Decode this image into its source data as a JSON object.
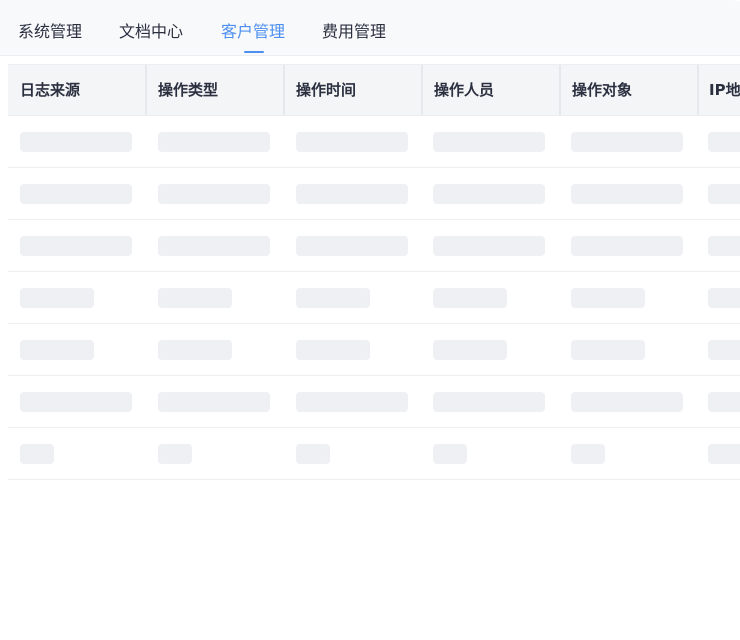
{
  "tabs": [
    {
      "label": "系统管理",
      "active": false
    },
    {
      "label": "文档中心",
      "active": false
    },
    {
      "label": "客户管理",
      "active": true
    },
    {
      "label": "费用管理",
      "active": false
    }
  ],
  "table": {
    "columns": [
      "日志来源",
      "操作类型",
      "操作时间",
      "操作人员",
      "操作对象",
      "IP地址"
    ],
    "loading_rows": 7
  },
  "colors": {
    "accent": "#4d8ff0",
    "text": "#2b3040",
    "header_bg": "#f4f5f7",
    "skeleton": "#eff0f4"
  }
}
